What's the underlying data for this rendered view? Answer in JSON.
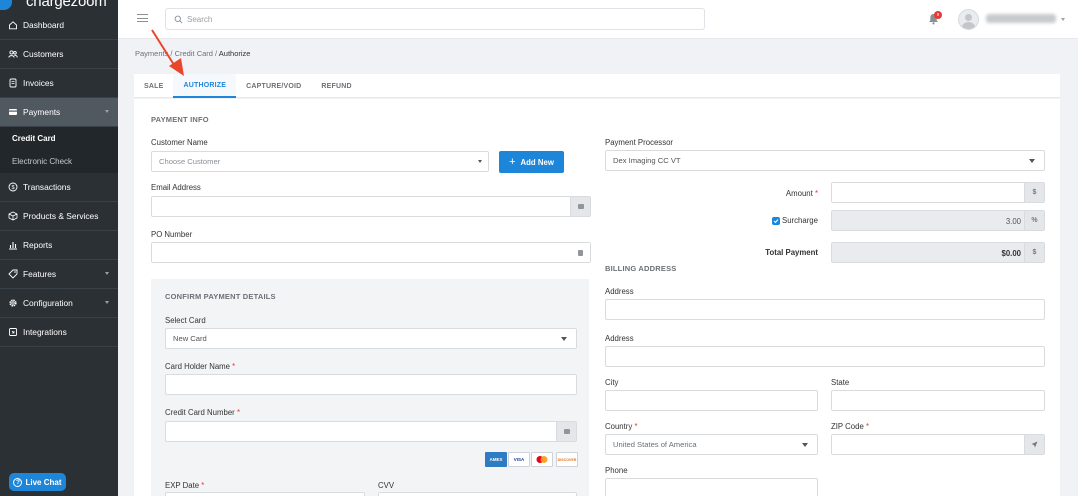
{
  "app": {
    "logo_text": "chargezoom",
    "brand_color": "#1e86d9",
    "sidebar_color": "#2b3035"
  },
  "sidebar": {
    "items": [
      {
        "label": "Dashboard",
        "icon": "home-icon"
      },
      {
        "label": "Customers",
        "icon": "users-icon"
      },
      {
        "label": "Invoices",
        "icon": "invoice-icon"
      },
      {
        "label": "Payments",
        "icon": "card-icon",
        "expanded": true
      },
      {
        "label": "Transactions",
        "icon": "dollar-icon"
      },
      {
        "label": "Products & Services",
        "icon": "box-icon"
      },
      {
        "label": "Reports",
        "icon": "bar-chart-icon"
      },
      {
        "label": "Features",
        "icon": "tag-icon"
      },
      {
        "label": "Configuration",
        "icon": "gear-icon"
      },
      {
        "label": "Integrations",
        "icon": "plug-icon"
      }
    ],
    "payments_sub": [
      {
        "label": "Credit Card",
        "active": true
      },
      {
        "label": "Electronic Check",
        "active": false
      }
    ],
    "live_chat": "Live Chat"
  },
  "topbar": {
    "search_placeholder": "Search",
    "notification_count": "9"
  },
  "breadcrumb": {
    "part1": "Payments / Credit Card / ",
    "current": "Authorize"
  },
  "tabs": [
    {
      "label": "SALE",
      "active": false
    },
    {
      "label": "AUTHORIZE",
      "active": true
    },
    {
      "label": "CAPTURE/VOID",
      "active": false
    },
    {
      "label": "REFUND",
      "active": false
    }
  ],
  "payment_info": {
    "title": "PAYMENT INFO",
    "customer_name_label": "Customer Name",
    "customer_placeholder": "Choose Customer",
    "add_new": "Add New",
    "email_label": "Email Address",
    "po_label": "PO Number",
    "processor_label": "Payment Processor",
    "processor_value": "Dex Imaging CC VT",
    "amount_label": "Amount",
    "amount_addon": "$",
    "surcharge_label": "Surcharge",
    "surcharge_value": "3.00",
    "surcharge_addon": "%",
    "total_label": "Total Payment",
    "total_value": "$0.00",
    "total_addon": "$"
  },
  "confirm": {
    "title": "CONFIRM PAYMENT DETAILS",
    "select_card_label": "Select Card",
    "select_card_value": "New Card",
    "holder_label": "Card Holder Name",
    "number_label": "Credit Card Number",
    "exp_label": "EXP Date",
    "cvv_label": "CVV",
    "card_logos": [
      "AMEX",
      "VISA",
      "MC",
      "DISCOVER"
    ]
  },
  "billing": {
    "title": "BILLING ADDRESS",
    "address1_label": "Address",
    "address2_label": "Address",
    "city_label": "City",
    "state_label": "State",
    "country_label": "Country",
    "country_value": "United States of America",
    "zip_label": "ZIP Code",
    "phone_label": "Phone"
  }
}
